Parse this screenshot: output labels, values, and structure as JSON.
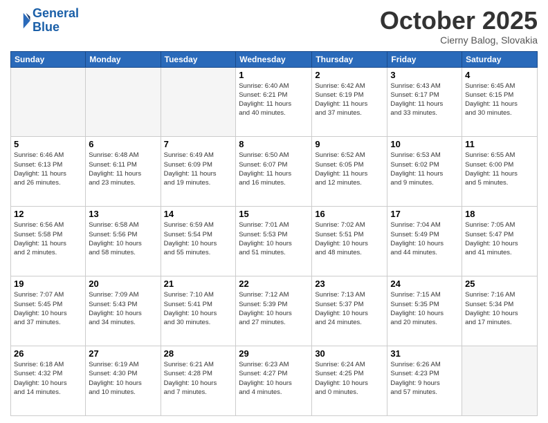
{
  "header": {
    "logo_line1": "General",
    "logo_line2": "Blue",
    "month": "October 2025",
    "location": "Cierny Balog, Slovakia"
  },
  "weekdays": [
    "Sunday",
    "Monday",
    "Tuesday",
    "Wednesday",
    "Thursday",
    "Friday",
    "Saturday"
  ],
  "weeks": [
    [
      {
        "day": "",
        "info": ""
      },
      {
        "day": "",
        "info": ""
      },
      {
        "day": "",
        "info": ""
      },
      {
        "day": "1",
        "info": "Sunrise: 6:40 AM\nSunset: 6:21 PM\nDaylight: 11 hours\nand 40 minutes."
      },
      {
        "day": "2",
        "info": "Sunrise: 6:42 AM\nSunset: 6:19 PM\nDaylight: 11 hours\nand 37 minutes."
      },
      {
        "day": "3",
        "info": "Sunrise: 6:43 AM\nSunset: 6:17 PM\nDaylight: 11 hours\nand 33 minutes."
      },
      {
        "day": "4",
        "info": "Sunrise: 6:45 AM\nSunset: 6:15 PM\nDaylight: 11 hours\nand 30 minutes."
      }
    ],
    [
      {
        "day": "5",
        "info": "Sunrise: 6:46 AM\nSunset: 6:13 PM\nDaylight: 11 hours\nand 26 minutes."
      },
      {
        "day": "6",
        "info": "Sunrise: 6:48 AM\nSunset: 6:11 PM\nDaylight: 11 hours\nand 23 minutes."
      },
      {
        "day": "7",
        "info": "Sunrise: 6:49 AM\nSunset: 6:09 PM\nDaylight: 11 hours\nand 19 minutes."
      },
      {
        "day": "8",
        "info": "Sunrise: 6:50 AM\nSunset: 6:07 PM\nDaylight: 11 hours\nand 16 minutes."
      },
      {
        "day": "9",
        "info": "Sunrise: 6:52 AM\nSunset: 6:05 PM\nDaylight: 11 hours\nand 12 minutes."
      },
      {
        "day": "10",
        "info": "Sunrise: 6:53 AM\nSunset: 6:02 PM\nDaylight: 11 hours\nand 9 minutes."
      },
      {
        "day": "11",
        "info": "Sunrise: 6:55 AM\nSunset: 6:00 PM\nDaylight: 11 hours\nand 5 minutes."
      }
    ],
    [
      {
        "day": "12",
        "info": "Sunrise: 6:56 AM\nSunset: 5:58 PM\nDaylight: 11 hours\nand 2 minutes."
      },
      {
        "day": "13",
        "info": "Sunrise: 6:58 AM\nSunset: 5:56 PM\nDaylight: 10 hours\nand 58 minutes."
      },
      {
        "day": "14",
        "info": "Sunrise: 6:59 AM\nSunset: 5:54 PM\nDaylight: 10 hours\nand 55 minutes."
      },
      {
        "day": "15",
        "info": "Sunrise: 7:01 AM\nSunset: 5:53 PM\nDaylight: 10 hours\nand 51 minutes."
      },
      {
        "day": "16",
        "info": "Sunrise: 7:02 AM\nSunset: 5:51 PM\nDaylight: 10 hours\nand 48 minutes."
      },
      {
        "day": "17",
        "info": "Sunrise: 7:04 AM\nSunset: 5:49 PM\nDaylight: 10 hours\nand 44 minutes."
      },
      {
        "day": "18",
        "info": "Sunrise: 7:05 AM\nSunset: 5:47 PM\nDaylight: 10 hours\nand 41 minutes."
      }
    ],
    [
      {
        "day": "19",
        "info": "Sunrise: 7:07 AM\nSunset: 5:45 PM\nDaylight: 10 hours\nand 37 minutes."
      },
      {
        "day": "20",
        "info": "Sunrise: 7:09 AM\nSunset: 5:43 PM\nDaylight: 10 hours\nand 34 minutes."
      },
      {
        "day": "21",
        "info": "Sunrise: 7:10 AM\nSunset: 5:41 PM\nDaylight: 10 hours\nand 30 minutes."
      },
      {
        "day": "22",
        "info": "Sunrise: 7:12 AM\nSunset: 5:39 PM\nDaylight: 10 hours\nand 27 minutes."
      },
      {
        "day": "23",
        "info": "Sunrise: 7:13 AM\nSunset: 5:37 PM\nDaylight: 10 hours\nand 24 minutes."
      },
      {
        "day": "24",
        "info": "Sunrise: 7:15 AM\nSunset: 5:35 PM\nDaylight: 10 hours\nand 20 minutes."
      },
      {
        "day": "25",
        "info": "Sunrise: 7:16 AM\nSunset: 5:34 PM\nDaylight: 10 hours\nand 17 minutes."
      }
    ],
    [
      {
        "day": "26",
        "info": "Sunrise: 6:18 AM\nSunset: 4:32 PM\nDaylight: 10 hours\nand 14 minutes."
      },
      {
        "day": "27",
        "info": "Sunrise: 6:19 AM\nSunset: 4:30 PM\nDaylight: 10 hours\nand 10 minutes."
      },
      {
        "day": "28",
        "info": "Sunrise: 6:21 AM\nSunset: 4:28 PM\nDaylight: 10 hours\nand 7 minutes."
      },
      {
        "day": "29",
        "info": "Sunrise: 6:23 AM\nSunset: 4:27 PM\nDaylight: 10 hours\nand 4 minutes."
      },
      {
        "day": "30",
        "info": "Sunrise: 6:24 AM\nSunset: 4:25 PM\nDaylight: 10 hours\nand 0 minutes."
      },
      {
        "day": "31",
        "info": "Sunrise: 6:26 AM\nSunset: 4:23 PM\nDaylight: 9 hours\nand 57 minutes."
      },
      {
        "day": "",
        "info": ""
      }
    ]
  ]
}
